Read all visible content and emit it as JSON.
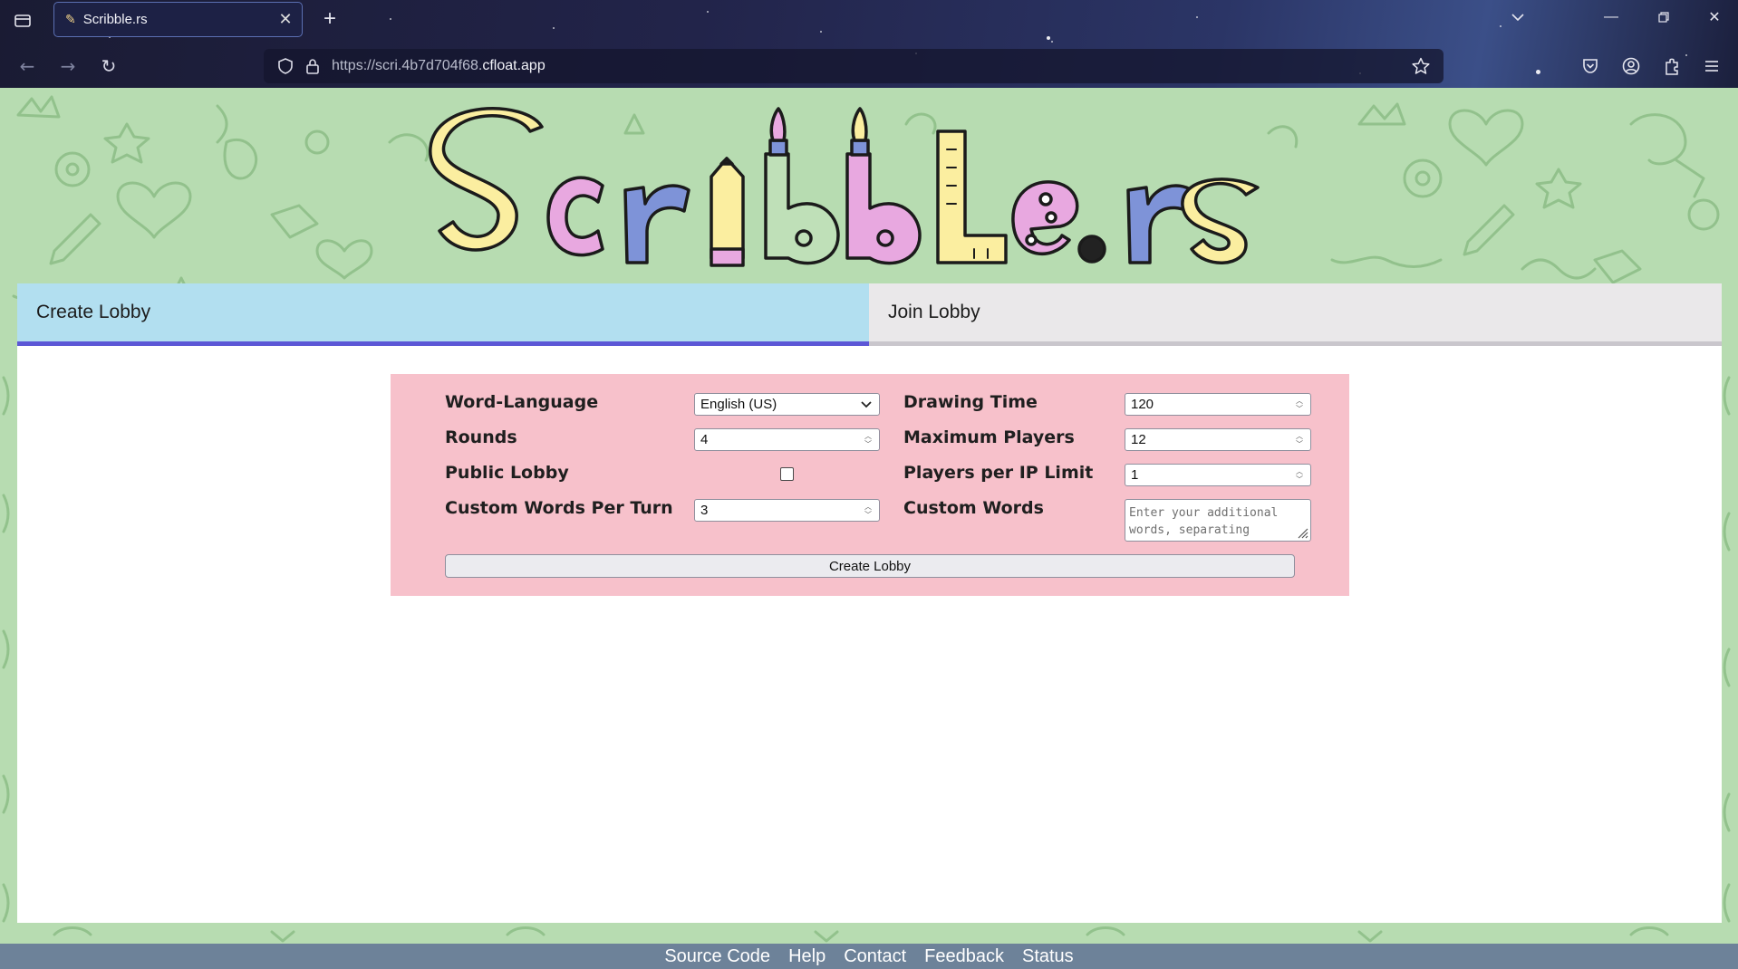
{
  "browser": {
    "tab_title": "Scribble.rs",
    "url_prefix": "https://scri.4b7d704f68.",
    "url_domain": "cfloat.app"
  },
  "logo": {
    "text": "Scribble.rs"
  },
  "lobby_tabs": [
    {
      "label": "Create Lobby",
      "active": true
    },
    {
      "label": "Join Lobby",
      "active": false
    }
  ],
  "form": {
    "word_language": {
      "label": "Word-Language",
      "value": "English (US)"
    },
    "drawing_time": {
      "label": "Drawing Time",
      "value": "120"
    },
    "rounds": {
      "label": "Rounds",
      "value": "4"
    },
    "max_players": {
      "label": "Maximum Players",
      "value": "12"
    },
    "public_lobby": {
      "label": "Public Lobby",
      "checked": false
    },
    "players_per_ip": {
      "label": "Players per IP Limit",
      "value": "1"
    },
    "custom_words_per_turn": {
      "label": "Custom Words Per Turn",
      "value": "3"
    },
    "custom_words": {
      "label": "Custom Words",
      "placeholder": "Enter your additional words, separating"
    },
    "submit_label": "Create Lobby"
  },
  "footer": {
    "links": [
      "Source Code",
      "Help",
      "Contact",
      "Feedback",
      "Status"
    ]
  },
  "colors": {
    "page_bg": "#b7dcb1",
    "active_tab": "#b2dff0",
    "active_tab_underline": "#5c57d6",
    "form_panel": "#f7c1cb",
    "footer_bg": "#6d8299"
  }
}
